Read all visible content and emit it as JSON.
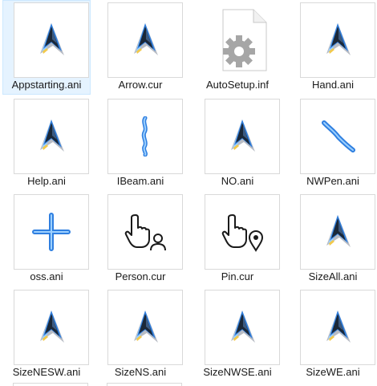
{
  "files": [
    {
      "name": "Appstarting.ani",
      "icon": "arrow-cursor-icon",
      "selected": true
    },
    {
      "name": "Arrow.cur",
      "icon": "arrow-cursor-icon"
    },
    {
      "name": "AutoSetup.inf",
      "icon": "settings-file-icon"
    },
    {
      "name": "Hand.ani",
      "icon": "arrow-cursor-icon"
    },
    {
      "name": "Help.ani",
      "icon": "arrow-cursor-icon"
    },
    {
      "name": "IBeam.ani",
      "icon": "ibeam-cursor-icon"
    },
    {
      "name": "NO.ani",
      "icon": "arrow-cursor-icon"
    },
    {
      "name": "NWPen.ani",
      "icon": "pen-cursor-icon"
    },
    {
      "name": "oss.ani",
      "icon": "cross-cursor-icon"
    },
    {
      "name": "Person.cur",
      "icon": "hand-person-cursor-icon"
    },
    {
      "name": "Pin.cur",
      "icon": "hand-pin-cursor-icon"
    },
    {
      "name": "SizeAll.ani",
      "icon": "arrow-cursor-icon"
    },
    {
      "name": "SizeNESW.ani",
      "icon": "arrow-cursor-icon"
    },
    {
      "name": "SizeNS.ani",
      "icon": "arrow-cursor-icon"
    },
    {
      "name": "SizeNWSE.ani",
      "icon": "arrow-cursor-icon"
    },
    {
      "name": "SizeWE.ani",
      "icon": "arrow-cursor-icon"
    }
  ],
  "colors": {
    "selection": "#e5f3ff",
    "selection_border": "#cce8ff",
    "cursor_blue": "#2f7fe0",
    "cursor_light_blue": "#9cd0ff",
    "cursor_dark": "#1b2838"
  }
}
